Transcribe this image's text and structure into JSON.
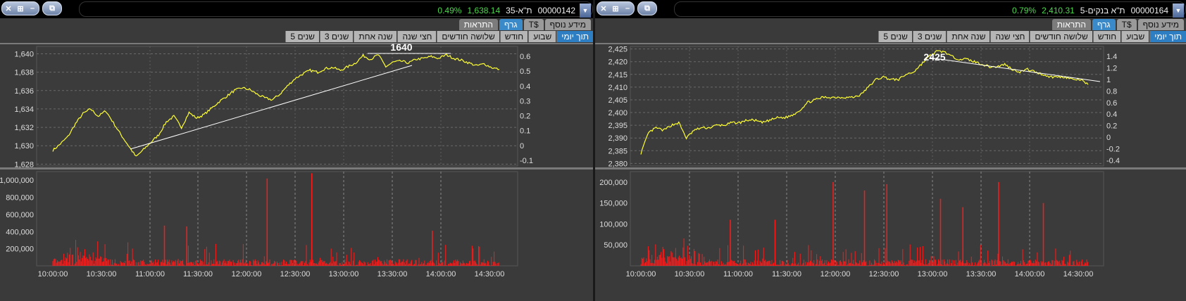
{
  "colors": {
    "price_line": "#ffff33",
    "volume": "#ff1a1a",
    "trend_line": "#ffffff",
    "tab_active": "#3a89c9",
    "pct_text": "#4cd94c"
  },
  "panels": [
    {
      "window_buttons": [
        "✕",
        "⊞",
        "–"
      ],
      "restore_icon": "⧉",
      "ticker": {
        "code": "00000142",
        "name": "ת\"א-35",
        "price": "1,638.14",
        "change": "0.49%"
      },
      "tabs_top": [
        "מידע נוסף",
        "T$",
        "גרף",
        "התראות"
      ],
      "tabs_periods": [
        "תוך יומי",
        "שבוע",
        "חודש",
        "שלושה חודשים",
        "חצי שנה",
        "שנה אחת",
        "3 שנים",
        "5 שנים"
      ],
      "annotation": "1640",
      "chart_data": {
        "type": "line",
        "series": [
          {
            "values": [
              1629.5,
              1630.2,
              1631.0,
              1632.4,
              1633.5,
              1634.0,
              1633.2,
              1633.8,
              1632.5,
              1631.2,
              1630.0,
              1628.8,
              1629.6,
              1630.4,
              1631.2,
              1632.6,
              1633.2,
              1632.0,
              1633.6,
              1633.0,
              1633.4,
              1634.1,
              1634.8,
              1635.4,
              1636.0,
              1636.3,
              1636.1,
              1635.6,
              1635.2,
              1635.0,
              1635.6,
              1636.5,
              1637.3,
              1637.8,
              1638.2,
              1638.0,
              1638.4,
              1638.5,
              1638.2,
              1638.6,
              1639.0,
              1639.8,
              1639.4,
              1639.9,
              1638.6,
              1639.1,
              1639.2,
              1639.0,
              1639.4,
              1639.5,
              1639.7,
              1639.5,
              1639.9,
              1639.5,
              1639.3,
              1639.0,
              1638.7,
              1638.9,
              1638.5,
              1638.3
            ]
          }
        ],
        "y_ticks": [
          "1,640",
          "1,638",
          "1,636",
          "1,634",
          "1,632",
          "1,630",
          "1,628"
        ],
        "y2_ticks": [
          "0.6",
          "0.5",
          "0.4",
          "0.3",
          "0.2",
          "0.1",
          "0",
          "-0.1"
        ],
        "ylim": [
          1627.8,
          1640.8
        ],
        "volume_ticks": [
          "1,000,000",
          "800,000",
          "600,000",
          "400,000",
          "200,000"
        ],
        "volume_max": 1100000,
        "volume_spikes": [
          [
            0.25,
            470000
          ],
          [
            0.3,
            460000
          ],
          [
            0.48,
            1020000
          ],
          [
            0.58,
            1080000
          ],
          [
            0.85,
            410000
          ]
        ],
        "x_ticks": [
          "10:00:00",
          "10:30:00",
          "11:00:00",
          "11:30:00",
          "12:00:00",
          "12:30:00",
          "13:00:00",
          "13:30:00",
          "14:00:00",
          "14:30:00"
        ]
      }
    },
    {
      "window_buttons": [
        "✕",
        "⊞",
        "–"
      ],
      "restore_icon": "⧉",
      "ticker": {
        "code": "00000164",
        "name": "ת\"א בנקים-5",
        "price": "2,410.31",
        "change": "0.79%"
      },
      "tabs_top": [
        "מידע נוסף",
        "T$",
        "גרף",
        "התראות"
      ],
      "tabs_periods": [
        "תוך יומי",
        "שבוע",
        "חודש",
        "שלושה חודשים",
        "חצי שנה",
        "שנה אחת",
        "3 שנים",
        "5 שנים"
      ],
      "annotation": "2425",
      "chart_data": {
        "type": "line",
        "series": [
          {
            "values": [
              2384,
              2392,
              2394,
              2393,
              2395,
              2396,
              2390,
              2393,
              2394,
              2394,
              2395,
              2395,
              2396,
              2396,
              2397,
              2397,
              2396,
              2397,
              2398,
              2398,
              2399,
              2401,
              2404,
              2405,
              2406,
              2406,
              2406,
              2406,
              2406,
              2407,
              2410,
              2413,
              2414,
              2413,
              2413,
              2415,
              2416,
              2419,
              2422,
              2424,
              2424,
              2422,
              2421,
              2421,
              2420,
              2419,
              2418,
              2418,
              2419,
              2417,
              2416,
              2417,
              2416,
              2415,
              2414,
              2414,
              2414,
              2413,
              2413,
              2411
            ]
          }
        ],
        "y_ticks": [
          "2,425",
          "2,420",
          "2,415",
          "2,410",
          "2,405",
          "2,400",
          "2,395",
          "2,390",
          "2,385",
          "2,380"
        ],
        "y2_ticks": [
          "1.4",
          "1.2",
          "1",
          "0.8",
          "0.6",
          "0.4",
          "0.2",
          "0",
          "-0.2",
          "-0.4"
        ],
        "ylim": [
          2379,
          2426
        ],
        "volume_ticks": [
          "200,000",
          "150,000",
          "100,000",
          "50,000"
        ],
        "volume_max": 225000,
        "volume_spikes": [
          [
            0.2,
            110000
          ],
          [
            0.3,
            110000
          ],
          [
            0.43,
            200000
          ],
          [
            0.5,
            180000
          ],
          [
            0.55,
            195000
          ],
          [
            0.67,
            160000
          ],
          [
            0.72,
            140000
          ],
          [
            0.8,
            200000
          ],
          [
            0.9,
            150000
          ]
        ],
        "x_ticks": [
          "10:00:00",
          "10:30:00",
          "11:00:00",
          "11:30:00",
          "12:00:00",
          "12:30:00",
          "13:00:00",
          "13:30:00",
          "14:00:00",
          "14:30:00"
        ]
      }
    }
  ]
}
